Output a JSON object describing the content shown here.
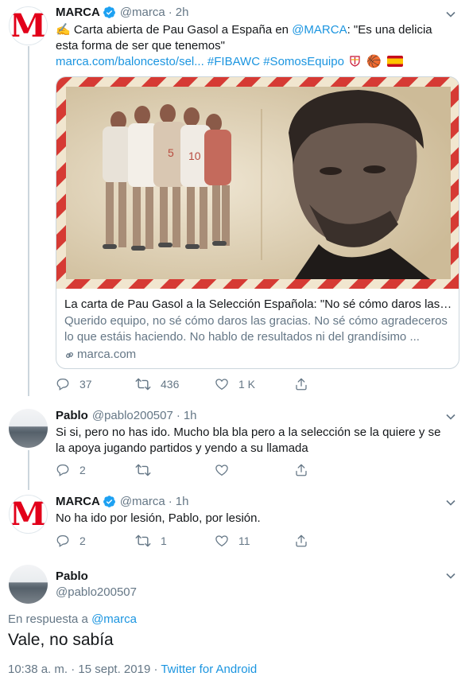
{
  "tweet1": {
    "name": "MARCA",
    "handle": "@marca",
    "time": "2h",
    "avatar_letter": "M",
    "text_pre": "✍️ Carta abierta de Pau Gasol a España en ",
    "text_mention": "@MARCA",
    "text_post": ": \"Es una delicia esta forma de ser que tenemos\"",
    "link_url": "marca.com/baloncesto/sel...",
    "hashtag1": "#FIBAWC",
    "hashtag2": "#SomosEquipo",
    "emojis": "🏀",
    "card": {
      "title": "La carta de Pau Gasol a la Selección Española: \"No sé cómo daros las gr...",
      "description": "Querido equipo, no sé cómo daros las gracias. No sé cómo agradeceros lo que estáis haciendo. No hablo de resultados ni del grandísimo ...",
      "domain": "marca.com"
    },
    "replies": "37",
    "retweets": "436",
    "likes": "1 K"
  },
  "tweet2": {
    "name": "Pablo",
    "handle": "@pablo200507",
    "time": "1h",
    "text": "Si si, pero no has ido. Mucho bla bla pero a la selección se la quiere y se la apoya jugando partidos y yendo a su llamada",
    "replies": "2"
  },
  "tweet3": {
    "name": "MARCA",
    "handle": "@marca",
    "time": "1h",
    "avatar_letter": "M",
    "text": "No ha ido por lesión, Pablo, por lesión.",
    "replies": "2",
    "retweets": "1",
    "likes": "11"
  },
  "main": {
    "name": "Pablo",
    "handle": "@pablo200507",
    "reply_prefix": "En respuesta a ",
    "reply_handle": "@marca",
    "text": "Vale, no sabía",
    "timestamp": "10:38 a. m. · 15 sept. 2019 · ",
    "app": "Twitter for Android"
  },
  "colors": {
    "link": "#1b95e0",
    "secondary": "#657786",
    "marca_red": "#e2001a",
    "verified": "#1da1f2"
  }
}
